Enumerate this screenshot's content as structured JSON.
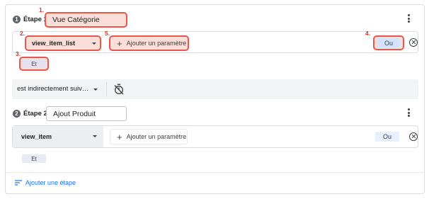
{
  "steps": [
    {
      "number": "1",
      "label": "Étape 1",
      "name": "Vue Catégorie",
      "event": "view_item_list",
      "add_param": "Ajouter un paramètre",
      "or_label": "Ou",
      "and_label": "Et"
    },
    {
      "number": "2",
      "label": "Étape 2",
      "name": "Ajout Produit",
      "event": "view_item",
      "add_param": "Ajouter un paramètre",
      "or_label": "Ou",
      "and_label": "Et"
    }
  ],
  "sequence": {
    "selector": "est indirectement suiv…"
  },
  "footer": {
    "add_step": "Ajouter une étape"
  },
  "annotations": [
    "1.",
    "2.",
    "3.",
    "4.",
    "5."
  ],
  "colors": {
    "highlight_border": "#e8574d",
    "highlight_fill": "#fcded8",
    "annotation_text": "#d93025",
    "link_blue": "#1a73e8"
  },
  "icons": [
    "kebab-menu-icon",
    "caret-down-icon",
    "plus-icon",
    "close-circle-icon",
    "timer-icon",
    "add-step-icon"
  ]
}
